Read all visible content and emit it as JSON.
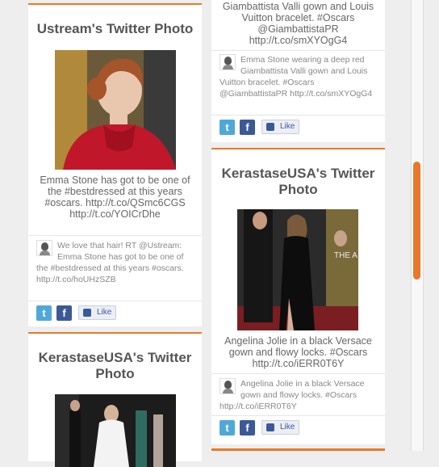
{
  "colors": {
    "accent": "#e8792a",
    "background": "#eeeeee",
    "card": "#ffffff",
    "twitter": "#4fa8d8",
    "facebook": "#3b5998"
  },
  "cards": {
    "c1": {
      "title": "Ustream's Twitter Photo",
      "caption": "Emma Stone has got to be one of the #bestdressed at this years #oscars. http://t.co/QSmc6CGS http://t.co/YOICrDhe",
      "tweet": "We love that hair! RT @Ustream: Emma Stone has got to be one of the #bestdressed at this years #oscars. http://t.co/hoUHzSZB",
      "like_label": "Like"
    },
    "c2": {
      "title": "KerastaseUSA's Twitter Photo"
    },
    "c3": {
      "caption": "Giambattista Valli gown and Louis Vuitton bracelet. #Oscars @GiambattistaPR http://t.co/smXYOgG4",
      "tweet": "Emma Stone wearing a deep red Giambattista Valli gown and Louis Vuitton bracelet. #Oscars @GiambattistaPR http://t.co/smXYOgG4",
      "like_label": "Like"
    },
    "c4": {
      "title": "KerastaseUSA's Twitter Photo",
      "caption": "Angelina Jolie in a black Versace gown and flowy locks. #Oscars http://t.co/iERR0T6Y",
      "tweet": "Angelina Jolie in a black Versace gown and flowy locks. #Oscars http://t.co/iERR0T6Y",
      "like_label": "Like"
    }
  },
  "icons": {
    "twitter": "twitter-icon",
    "facebook": "facebook-icon",
    "like": "like-thumb-icon"
  }
}
